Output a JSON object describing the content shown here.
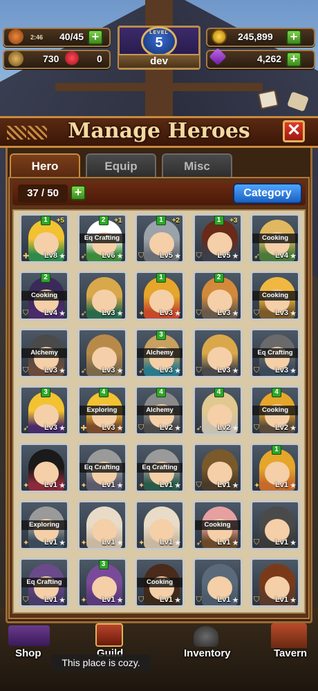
{
  "hud": {
    "timer": "2:46",
    "stamina": "40/45",
    "hearts_count": "730",
    "hearts_extra": "0",
    "gold": "245,899",
    "gems": "4,262",
    "level_label": "LEVEL",
    "level": "5",
    "player_name": "dev",
    "plus": "+"
  },
  "panel": {
    "title": "Manage Heroes",
    "close": "✕",
    "tabs": [
      "Hero",
      "Equip",
      "Misc"
    ],
    "count": "37 / 50",
    "category": "Category"
  },
  "heroes": [
    {
      "badge": "1",
      "bonus": "+5",
      "job": "",
      "lvl": "Lv8",
      "cls": "✚",
      "hair": "#f2c230",
      "shirt": "#2e8a4a"
    },
    {
      "badge": "2",
      "bonus": "+1",
      "job": "Eq Crafting",
      "lvl": "Lv6",
      "cls": "➶",
      "hair": "#ffffff",
      "shirt": "#3d8a3a"
    },
    {
      "badge": "1",
      "bonus": "+2",
      "job": "",
      "lvl": "Lv5",
      "cls": "⛉",
      "hair": "#9aa2aa",
      "shirt": "#6a6f75"
    },
    {
      "badge": "1",
      "bonus": "+3",
      "job": "",
      "lvl": "Lv5",
      "cls": "⛉",
      "hair": "#6a2a18",
      "shirt": "#3a3f4a"
    },
    {
      "badge": "",
      "bonus": "",
      "job": "Cooking",
      "lvl": "Lv4",
      "cls": "➶",
      "hair": "#e0b860",
      "shirt": "#4a7a3a"
    },
    {
      "badge": "2",
      "bonus": "",
      "job": "Cooking",
      "lvl": "Lv4",
      "cls": "⛉",
      "hair": "#3a2a5a",
      "shirt": "#4a2a6a"
    },
    {
      "badge": "",
      "bonus": "",
      "job": "",
      "lvl": "Lv3",
      "cls": "➶",
      "hair": "#d9a84a",
      "shirt": "#2a6a4a"
    },
    {
      "badge": "1",
      "bonus": "",
      "job": "",
      "lvl": "Lv3",
      "cls": "✦",
      "hair": "#e5a62a",
      "shirt": "#c6492a"
    },
    {
      "badge": "2",
      "bonus": "",
      "job": "",
      "lvl": "Lv3",
      "cls": "⛉",
      "hair": "#d28a3a",
      "shirt": "#6a5a4a"
    },
    {
      "badge": "",
      "bonus": "",
      "job": "Cooking",
      "lvl": "Lv3",
      "cls": "⛉",
      "hair": "#f0b840",
      "shirt": "#7a5a2a"
    },
    {
      "badge": "",
      "bonus": "",
      "job": "Alchemy",
      "lvl": "Lv3",
      "cls": "⛉",
      "hair": "#4a4a4a",
      "shirt": "#6a4a3a"
    },
    {
      "badge": "",
      "bonus": "",
      "job": "",
      "lvl": "Lv3",
      "cls": "➶",
      "hair": "#b88a4a",
      "shirt": "#7a6a4a"
    },
    {
      "badge": "3",
      "bonus": "",
      "job": "Alchemy",
      "lvl": "Lv3",
      "cls": "➶",
      "hair": "#c8a060",
      "shirt": "#2a7a8a"
    },
    {
      "badge": "",
      "bonus": "",
      "job": "",
      "lvl": "Lv3",
      "cls": "⛉",
      "hair": "#d9a84a",
      "shirt": "#4a4a4a"
    },
    {
      "badge": "",
      "bonus": "",
      "job": "Eq Crafting",
      "lvl": "Lv3",
      "cls": "⛉",
      "hair": "#6a6a6a",
      "shirt": "#3a4a5a"
    },
    {
      "badge": "3",
      "bonus": "",
      "job": "",
      "lvl": "Lv3",
      "cls": "➶",
      "hair": "#f2c230",
      "shirt": "#4a2a6a"
    },
    {
      "badge": "4",
      "bonus": "",
      "job": "Exploring",
      "lvl": "Lv3",
      "cls": "✚",
      "hair": "#f2c230",
      "shirt": "#7a4a2a"
    },
    {
      "badge": "4",
      "bonus": "",
      "job": "Alchemy",
      "lvl": "Lv2",
      "cls": "⛉",
      "hair": "#8a8a8a",
      "shirt": "#4a4a4a"
    },
    {
      "badge": "4",
      "bonus": "",
      "job": "",
      "lvl": "Lv2",
      "cls": "➶",
      "hair": "#e0c890",
      "shirt": "#c8c0b0"
    },
    {
      "badge": "4",
      "bonus": "",
      "job": "Cooking",
      "lvl": "Lv2",
      "cls": "⛉",
      "hair": "#e5a62a",
      "shirt": "#5a4a3a"
    },
    {
      "badge": "",
      "bonus": "",
      "job": "",
      "lvl": "Lv1",
      "cls": "✦",
      "hair": "#1a1a1a",
      "shirt": "#8a2a3a"
    },
    {
      "badge": "",
      "bonus": "",
      "job": "Eq Crafting",
      "lvl": "Lv1",
      "cls": "✦",
      "hair": "#9a9a9a",
      "shirt": "#5a5a6a"
    },
    {
      "badge": "",
      "bonus": "",
      "job": "Eq Crafting",
      "lvl": "Lv1",
      "cls": "✦",
      "hair": "#9a9a9a",
      "shirt": "#2a5a4a"
    },
    {
      "badge": "",
      "bonus": "",
      "job": "",
      "lvl": "Lv1",
      "cls": "⛉",
      "hair": "#7a5a2a",
      "shirt": "#4a3a2a"
    },
    {
      "badge": "1",
      "bonus": "",
      "job": "",
      "lvl": "Lv1",
      "cls": "✦",
      "hair": "#e5a62a",
      "shirt": "#c66a2a"
    },
    {
      "badge": "",
      "bonus": "",
      "job": "Exploring",
      "lvl": "Lv1",
      "cls": "✦",
      "hair": "#9a9a9a",
      "shirt": "#3a4a5a"
    },
    {
      "badge": "",
      "bonus": "",
      "job": "",
      "lvl": "Lv1",
      "cls": "✦",
      "hair": "#e8dcc8",
      "shirt": "#c8b8a0"
    },
    {
      "badge": "",
      "bonus": "",
      "job": "",
      "lvl": "Lv1",
      "cls": "✦",
      "hair": "#e8dcc8",
      "shirt": "#c8b8a0"
    },
    {
      "badge": "",
      "bonus": "",
      "job": "Cooking",
      "lvl": "Lv1",
      "cls": "➶",
      "hair": "#e6a0a0",
      "shirt": "#6a4a2a"
    },
    {
      "badge": "",
      "bonus": "",
      "job": "",
      "lvl": "Lv1",
      "cls": "⛉",
      "hair": "#4a4a4a",
      "shirt": "#3a3a3a"
    },
    {
      "badge": "",
      "bonus": "",
      "job": "Eq Crafting",
      "lvl": "Lv1",
      "cls": "⛉",
      "hair": "#6a4a8a",
      "shirt": "#4a3a6a"
    },
    {
      "badge": "3",
      "bonus": "",
      "job": "",
      "lvl": "Lv1",
      "cls": "✦",
      "hair": "#7a4a9a",
      "shirt": "#5a3a7a"
    },
    {
      "badge": "",
      "bonus": "",
      "job": "Cooking",
      "lvl": "Lv1",
      "cls": "⛉",
      "hair": "#4a2a1a",
      "shirt": "#3a2a1a"
    },
    {
      "badge": "",
      "bonus": "",
      "job": "",
      "lvl": "Lv1",
      "cls": "⛉",
      "hair": "#5a6a7a",
      "shirt": "#4a5a6a"
    },
    {
      "badge": "",
      "bonus": "",
      "job": "",
      "lvl": "Lv1",
      "cls": "⛉",
      "hair": "#7a3a1a",
      "shirt": "#5a3a2a"
    }
  ],
  "nav": {
    "shop": "Shop",
    "guild": "Guild",
    "inventory": "Inventory",
    "tavern": "Tavern",
    "toast": "This place is cozy."
  }
}
